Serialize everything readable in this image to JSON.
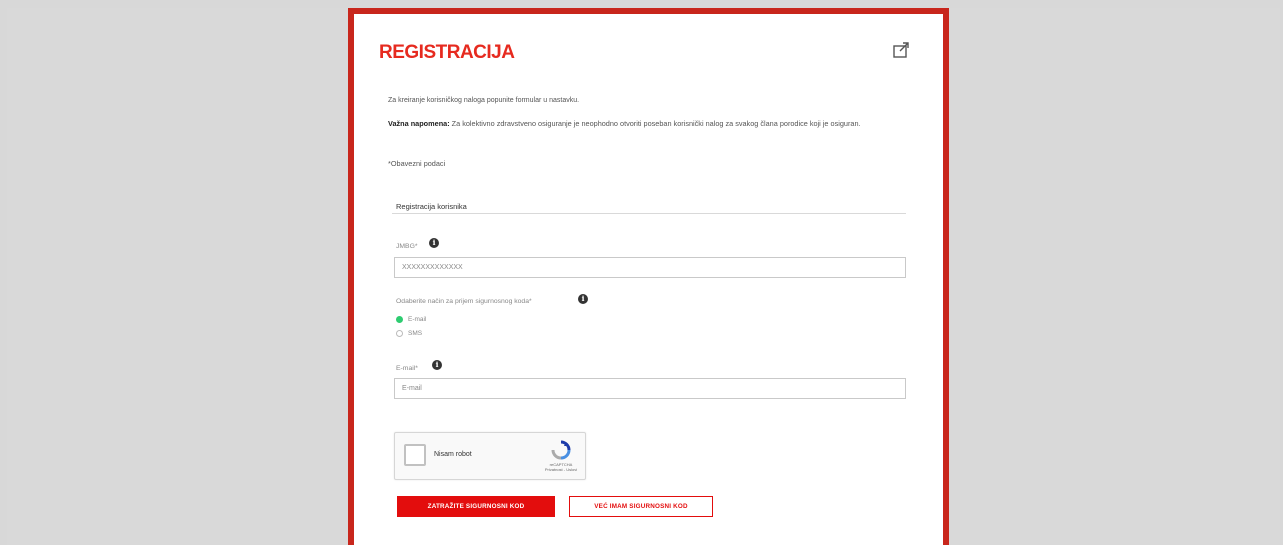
{
  "title": "REGISTRACIJA",
  "intro": "Za kreiranje korisničkog naloga popunite formular u nastavku.",
  "note": {
    "label": "Važna napomena:",
    "text": "Za kolektivno zdravstveno osiguranje je neophodno otvoriti poseban korisnički nalog za svakog člana porodice koji je osiguran."
  },
  "required_note": "*Obavezni podaci",
  "section_title": "Registracija korisnika",
  "jmbg": {
    "label": "JMBG*",
    "value": "XXXXXXXXXXXXX"
  },
  "method": {
    "label": "Odaberite način za prijem sigurnosnog koda*",
    "options": [
      "E-mail",
      "SMS"
    ],
    "selected": "E-mail"
  },
  "email": {
    "label": "E-mail*",
    "placeholder": "E-mail"
  },
  "captcha": {
    "label": "Nisam robot",
    "brand": "reCAPTCHA",
    "links": "Privatnost - Uslovi"
  },
  "buttons": {
    "primary": "ZATRAŽITE SIGURNOSNI KOD",
    "secondary": "VEĆ IMAM SIGURNOSNI KOD"
  },
  "colors": {
    "accent": "#e30d0d",
    "frame": "#c8261c",
    "radio_selected": "#2ecc71"
  }
}
